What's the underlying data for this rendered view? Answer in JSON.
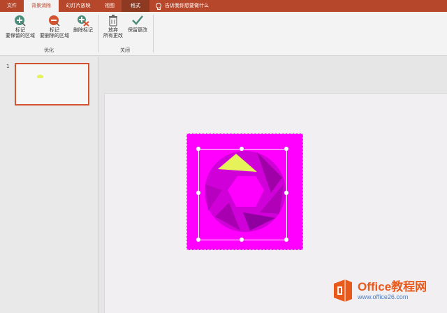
{
  "tabs": [
    {
      "label": "文件"
    },
    {
      "label": "背景消除"
    },
    {
      "label": "幻灯片放映"
    },
    {
      "label": "视图"
    },
    {
      "label": "格式"
    }
  ],
  "tell_me": "告诉我你想要做什么",
  "ribbon": {
    "mark_keep": {
      "line1": "标记",
      "line2": "要保留的区域"
    },
    "mark_remove": {
      "line1": "标记",
      "line2": "要删除的区域"
    },
    "delete_mark": {
      "line1": "删除标记"
    },
    "discard": {
      "line1": "放弃",
      "line2": "所有更改"
    },
    "keep_changes": {
      "line1": "保留更改"
    },
    "group_optimize": "优化",
    "group_close": "关闭"
  },
  "thumbnails": [
    {
      "number": "1"
    }
  ],
  "watermark": {
    "title": "Office教程网",
    "url": "www.office26.com"
  },
  "colors": {
    "accent": "#b7472a",
    "thumb_border": "#d35230",
    "image_bg": "#ff00ff",
    "highlight": "#e5f25a",
    "watermark_orange": "#e8591c",
    "watermark_blue": "#4a7fc1"
  }
}
